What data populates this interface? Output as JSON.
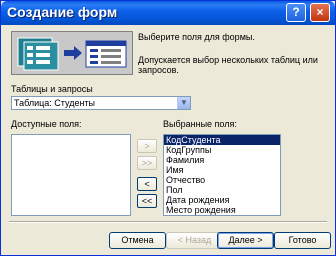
{
  "window": {
    "title": "Создание форм",
    "help_label": "?",
    "close_label": "×"
  },
  "description": {
    "line1": "Выберите поля для формы.",
    "line2": "Допускается выбор нескольких таблиц или запросов."
  },
  "tables_label": "Таблицы и запросы",
  "table_select": {
    "value": "Таблица: Студенты",
    "arrow": "▼"
  },
  "available_label": "Доступные поля:",
  "available_fields": [],
  "selected_label": "Выбранные поля:",
  "selected_fields": [
    "КодСтудента",
    "КодГруппы",
    "Фамилия",
    "Имя",
    "Отчество",
    "Пол",
    "Дата рождения",
    "Место рождения"
  ],
  "move_buttons": {
    "add_one": ">",
    "add_all": ">>",
    "remove_one": "<",
    "remove_all": "<<"
  },
  "buttons": {
    "cancel": "Отмена",
    "back": "< Назад",
    "next": "Далее >",
    "finish": "Готово"
  }
}
